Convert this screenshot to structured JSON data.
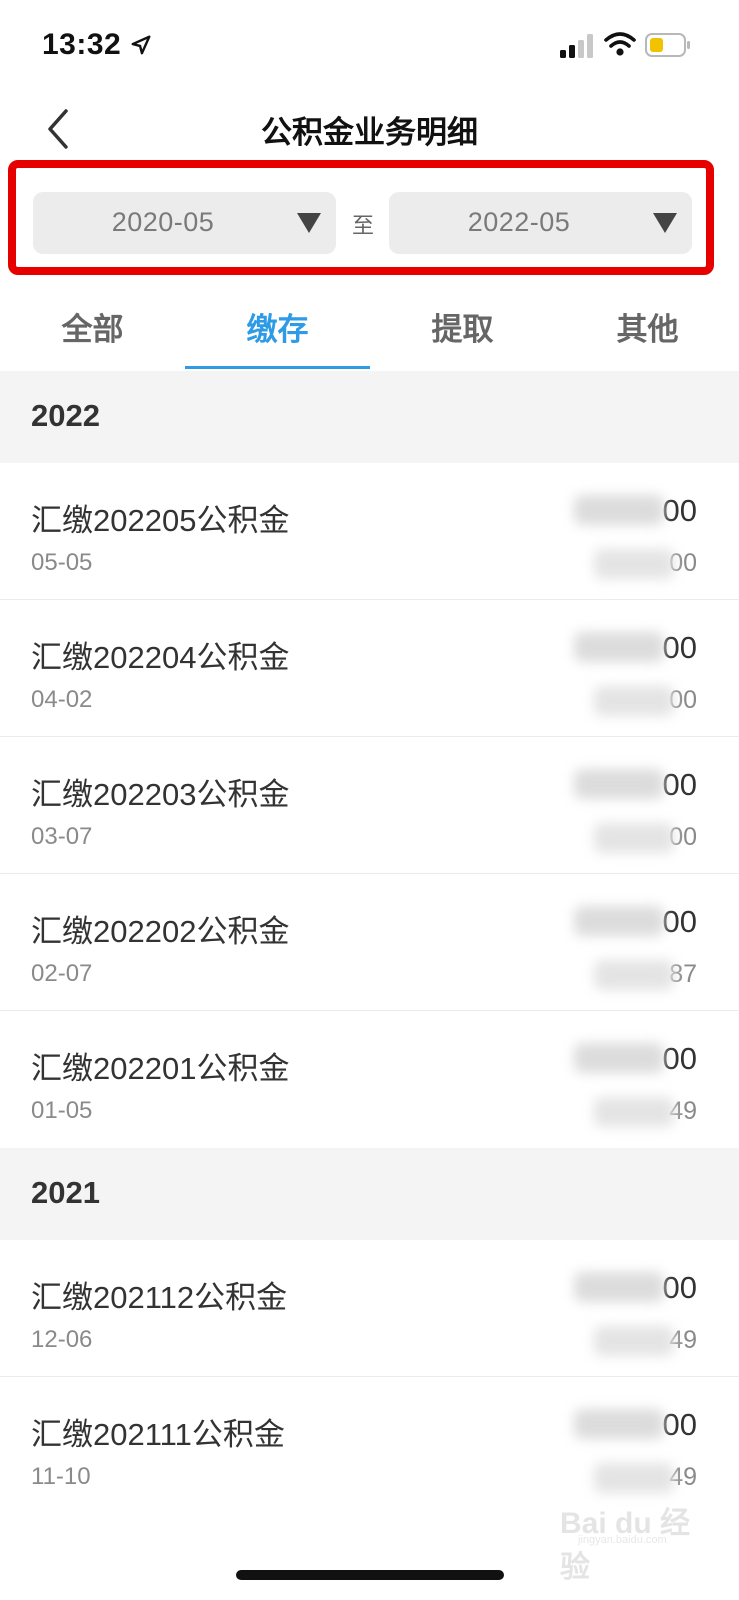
{
  "status_bar": {
    "time": "13:32"
  },
  "header": {
    "title": "公积金业务明细"
  },
  "date_range": {
    "start": "2020-05",
    "separator": "至",
    "end": "2022-05"
  },
  "tabs": [
    {
      "label": "全部",
      "active": false
    },
    {
      "label": "缴存",
      "active": true
    },
    {
      "label": "提取",
      "active": false
    },
    {
      "label": "其他",
      "active": false
    }
  ],
  "groups": [
    {
      "year": "2022",
      "rows": [
        {
          "title": "汇缴202205公积金",
          "date": "05-05",
          "amount_visible": "00",
          "balance_visible": "00"
        },
        {
          "title": "汇缴202204公积金",
          "date": "04-02",
          "amount_visible": "00",
          "balance_visible": "00"
        },
        {
          "title": "汇缴202203公积金",
          "date": "03-07",
          "amount_visible": "00",
          "balance_visible": "00"
        },
        {
          "title": "汇缴202202公积金",
          "date": "02-07",
          "amount_visible": "00",
          "balance_visible": "87"
        },
        {
          "title": "汇缴202201公积金",
          "date": "01-05",
          "amount_visible": "00",
          "balance_visible": "49"
        }
      ]
    },
    {
      "year": "2021",
      "rows": [
        {
          "title": "汇缴202112公积金",
          "date": "12-06",
          "amount_visible": "00",
          "balance_visible": "49"
        },
        {
          "title": "汇缴202111公积金",
          "date": "11-10",
          "amount_visible": "00",
          "balance_visible": "49"
        }
      ]
    }
  ],
  "colors": {
    "accent": "#2e9be6",
    "highlight_border": "#e60000",
    "section_bg": "#f4f4f4"
  },
  "watermark": {
    "brand": "Bai du 经验",
    "url": "jingyan.baidu.com"
  }
}
